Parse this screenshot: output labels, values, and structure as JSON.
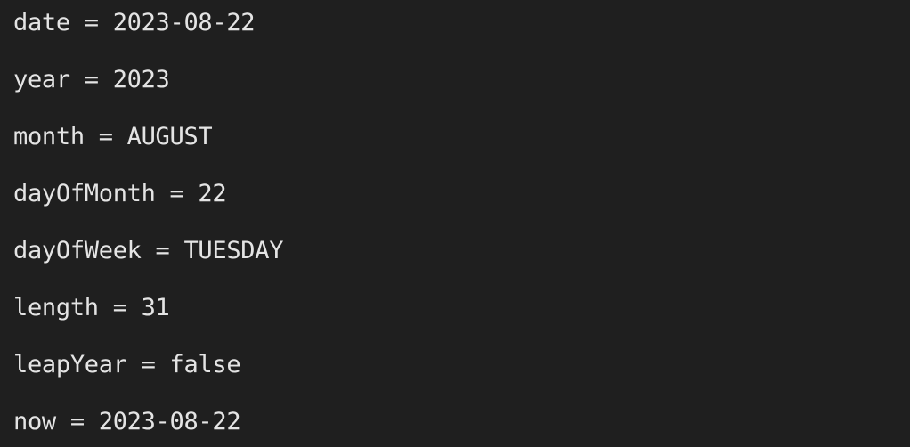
{
  "console": {
    "lines": [
      "date = 2023-08-22",
      "year = 2023",
      "month = AUGUST",
      "dayOfMonth = 22",
      "dayOfWeek = TUESDAY",
      "length = 31",
      "leapYear = false",
      "now = 2023-08-22"
    ]
  }
}
